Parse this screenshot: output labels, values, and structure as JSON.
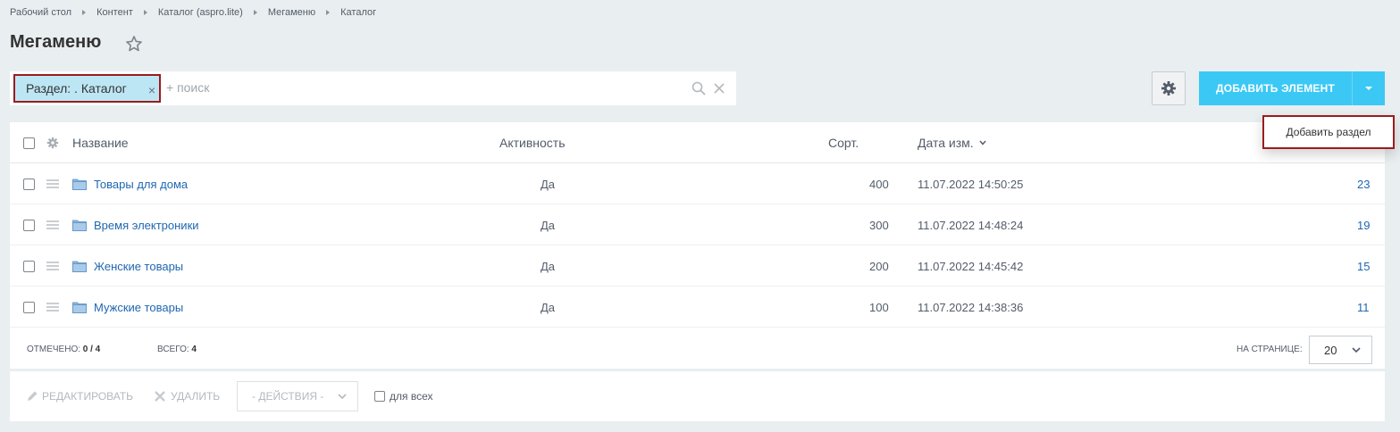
{
  "breadcrumbs": [
    "Рабочий стол",
    "Контент",
    "Каталог (aspro.lite)",
    "Мегаменю",
    "Каталог"
  ],
  "page_title": "Мегаменю",
  "filter": {
    "chip_label": "Раздел: . Каталог",
    "placeholder": "+ поиск"
  },
  "toolbar": {
    "add_element_label": "ДОБАВИТЬ ЭЛЕМЕНТ",
    "dropdown_item": "Добавить раздел"
  },
  "grid": {
    "columns": {
      "name": "Название",
      "activity": "Активность",
      "sort": "Сорт.",
      "date": "Дата изм."
    },
    "rows": [
      {
        "name": "Товары для дома",
        "active": "Да",
        "sort": "400",
        "date": "11.07.2022 14:50:25",
        "id": "23"
      },
      {
        "name": "Время электроники",
        "active": "Да",
        "sort": "300",
        "date": "11.07.2022 14:48:24",
        "id": "19"
      },
      {
        "name": "Женские товары",
        "active": "Да",
        "sort": "200",
        "date": "11.07.2022 14:45:42",
        "id": "15"
      },
      {
        "name": "Мужские товары",
        "active": "Да",
        "sort": "100",
        "date": "11.07.2022 14:38:36",
        "id": "11"
      }
    ],
    "footer": {
      "marked_label": "ОТМЕЧЕНО:",
      "marked_value": "0 / 4",
      "total_label": "ВСЕГО:",
      "total_value": "4",
      "per_page_label": "НА СТРАНИЦЕ:",
      "per_page_value": "20"
    }
  },
  "actions": {
    "edit": "РЕДАКТИРОВАТЬ",
    "delete": "УДАЛИТЬ",
    "select_placeholder": "- ДЕЙСТВИЯ -",
    "for_all": "для всех"
  },
  "colors": {
    "accent": "#3bc8f5",
    "link": "#2067b0",
    "highlight_border": "#9b1c1c"
  }
}
